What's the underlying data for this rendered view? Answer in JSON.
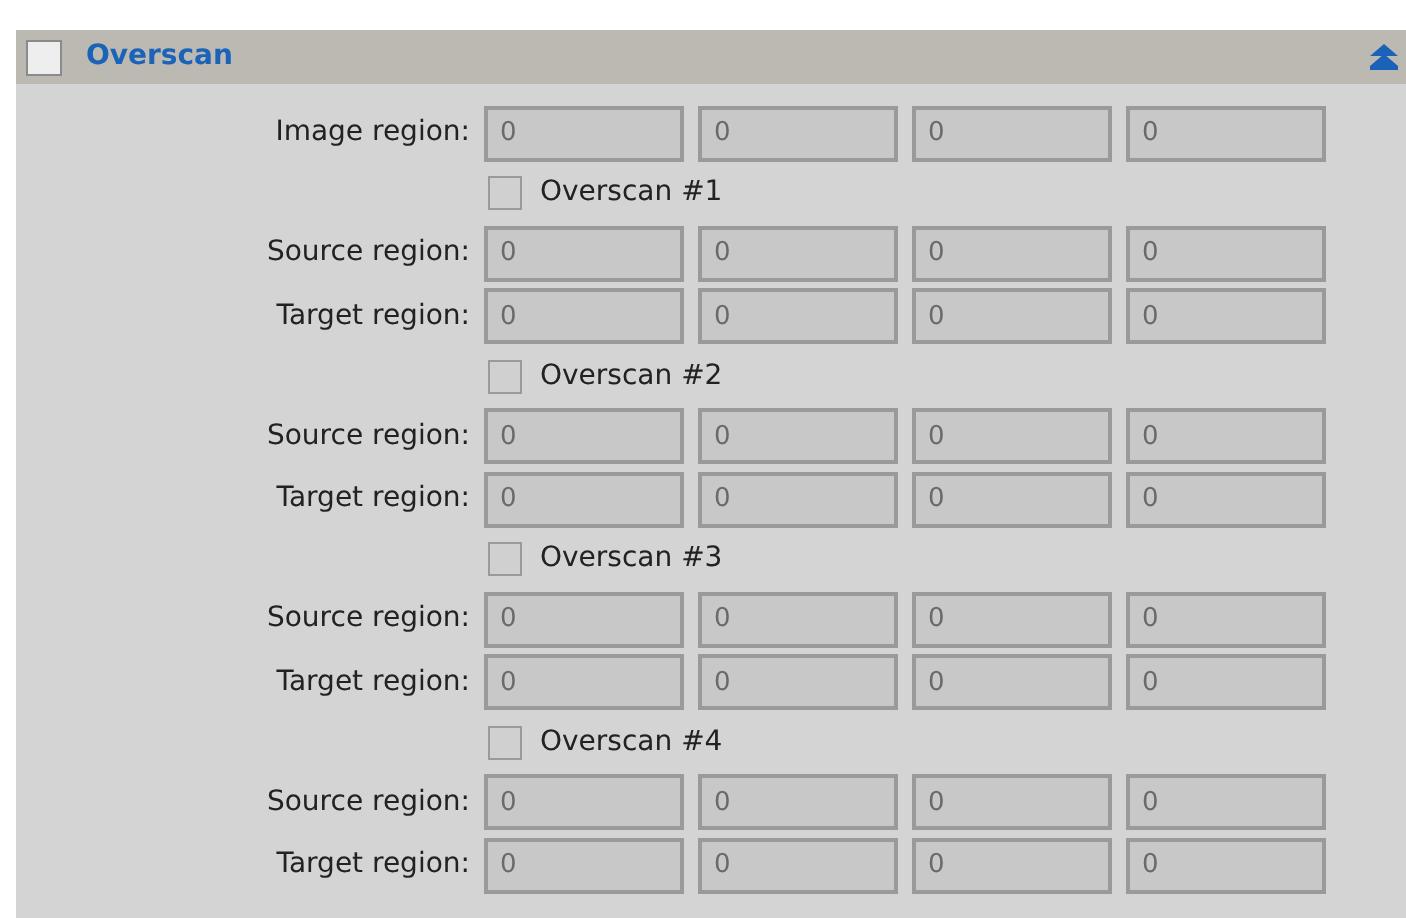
{
  "panel": {
    "title": "Overscan",
    "checked": false,
    "expanded": true
  },
  "image_region": {
    "label": "Image region:",
    "disabled": true,
    "values": [
      "0",
      "0",
      "0",
      "0"
    ]
  },
  "overscans": [
    {
      "label": "Overscan #1",
      "checked": false,
      "source": {
        "label": "Source region:",
        "disabled": true,
        "values": [
          "0",
          "0",
          "0",
          "0"
        ]
      },
      "target": {
        "label": "Target region:",
        "disabled": true,
        "values": [
          "0",
          "0",
          "0",
          "0"
        ]
      }
    },
    {
      "label": "Overscan #2",
      "checked": false,
      "source": {
        "label": "Source region:",
        "disabled": true,
        "values": [
          "0",
          "0",
          "0",
          "0"
        ]
      },
      "target": {
        "label": "Target region:",
        "disabled": true,
        "values": [
          "0",
          "0",
          "0",
          "0"
        ]
      }
    },
    {
      "label": "Overscan #3",
      "checked": false,
      "source": {
        "label": "Source region:",
        "disabled": true,
        "values": [
          "0",
          "0",
          "0",
          "0"
        ]
      },
      "target": {
        "label": "Target region:",
        "disabled": true,
        "values": [
          "0",
          "0",
          "0",
          "0"
        ]
      }
    },
    {
      "label": "Overscan #4",
      "checked": false,
      "source": {
        "label": "Source region:",
        "disabled": true,
        "values": [
          "0",
          "0",
          "0",
          "0"
        ]
      },
      "target": {
        "label": "Target region:",
        "disabled": true,
        "values": [
          "0",
          "0",
          "0",
          "0"
        ]
      }
    }
  ]
}
